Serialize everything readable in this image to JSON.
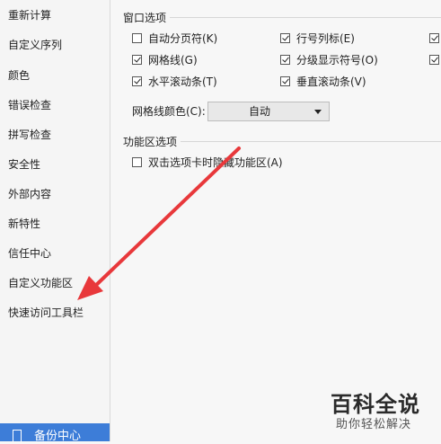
{
  "sidebar": {
    "items": [
      {
        "label": "重新计算"
      },
      {
        "label": "自定义序列"
      },
      {
        "label": "颜色"
      },
      {
        "label": "错误检查"
      },
      {
        "label": "拼写检查"
      },
      {
        "label": "安全性"
      },
      {
        "label": "外部内容"
      },
      {
        "label": "新特性"
      },
      {
        "label": "信任中心"
      },
      {
        "label": "自定义功能区"
      },
      {
        "label": "快速访问工具栏"
      }
    ],
    "backup_label": "备份中心"
  },
  "window_options": {
    "title": "窗口选项",
    "checkboxes": [
      {
        "label": "自动分页符(K)",
        "checked": false
      },
      {
        "label": "行号列标(E)",
        "checked": true
      },
      {
        "label": "网格线(G)",
        "checked": true
      },
      {
        "label": "分级显示符号(O)",
        "checked": true
      },
      {
        "label": "水平滚动条(T)",
        "checked": true
      },
      {
        "label": "垂直滚动条(V)",
        "checked": true
      }
    ],
    "gridline_color_label": "网格线颜色(C):",
    "gridline_color_value": "自动"
  },
  "ribbon_options": {
    "title": "功能区选项",
    "checkboxes": [
      {
        "label": "双击选项卡时隐藏功能区(A)",
        "checked": false
      }
    ]
  },
  "watermark": {
    "main": "百科全说",
    "sub": "助你轻松解决"
  },
  "colors": {
    "arrow": "#e8383b",
    "accent": "#3d7dd8"
  }
}
